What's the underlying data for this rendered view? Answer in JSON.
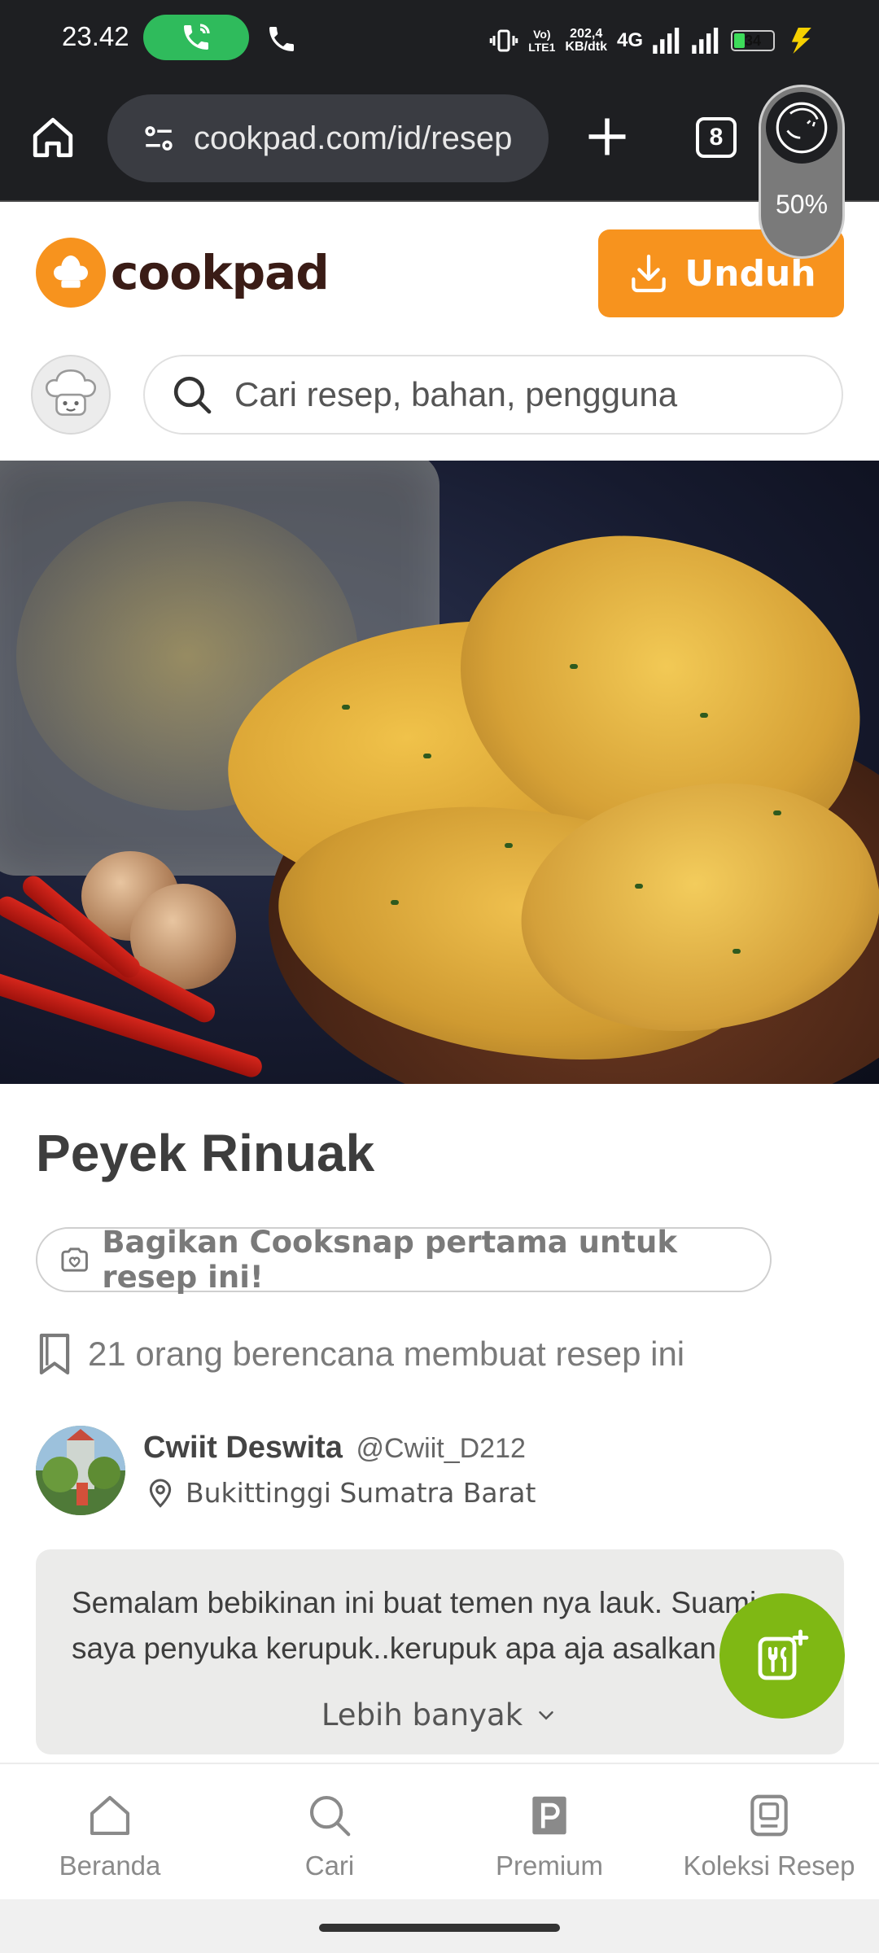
{
  "status_bar": {
    "time": "23.42",
    "network_rate": "202,4\nKB/dtk",
    "network_type": "4G",
    "volte": "Vo)\nLTE1",
    "battery_level": "34",
    "battery_fraction": 0.34
  },
  "browser": {
    "url": "cookpad.com/id/resep",
    "tab_count": "8",
    "assistant_percent": "50%"
  },
  "header": {
    "logo_text": "cookpad",
    "download_label": "Unduh",
    "search_placeholder": "Cari resep, bahan, pengguna"
  },
  "recipe": {
    "title": "Peyek Rinuak",
    "cooksnap_label": "Bagikan Cooksnap pertama untuk resep ini!",
    "planners_text": "21 orang berencana membuat resep ini",
    "author_name": "Cwiit Deswita",
    "author_handle": "@Cwiit_D212",
    "author_location": "Bukittinggi Sumatra Barat",
    "description": "Semalam bebikinan ini buat temen nya lauk. Suami\nsaya penyuka kerupuk..kerupuk apa aja asalkan",
    "more_label": "Lebih banyak"
  },
  "bottom_nav": [
    {
      "label": "Beranda",
      "icon": "home-icon"
    },
    {
      "label": "Cari",
      "icon": "search-icon"
    },
    {
      "label": "Premium",
      "icon": "premium-icon"
    },
    {
      "label": "Koleksi Resep",
      "icon": "recipe-collection-icon"
    }
  ],
  "colors": {
    "brand_orange": "#f7931e",
    "fab_green": "#7fb814",
    "chrome_dark": "#1e1f22"
  }
}
